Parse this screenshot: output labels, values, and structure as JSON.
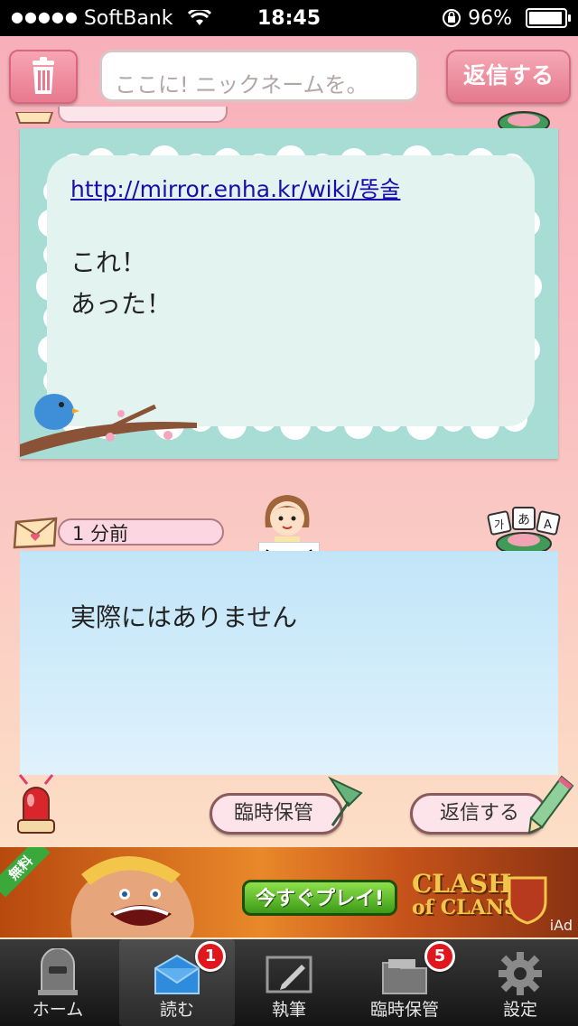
{
  "status_bar": {
    "carrier": "SoftBank",
    "time": "18:45",
    "battery": "96%"
  },
  "top_bar": {
    "nickname_placeholder": "ここに! ニックネームを。",
    "reply_label": "返信する"
  },
  "letters": [
    {
      "link": "http://mirror.enha.kr/wiki/똥술",
      "message_lines": "これ！\nあった！"
    },
    {
      "time_ago": "1 分前",
      "country_flag": "south-korea-flag-icon",
      "message": "実際にはありません"
    }
  ],
  "actions": {
    "temp_save_label": "臨時保管",
    "reply_label": "返信する"
  },
  "ad": {
    "free_label": "無料",
    "cta_label": "今すぐプレイ!",
    "brand_line1": "CLASH",
    "brand_line2": "of CLANS",
    "iad": "iAd"
  },
  "tabs": [
    {
      "label": "ホーム",
      "icon": "mailbox-icon"
    },
    {
      "label": "読む",
      "icon": "open-envelope-icon",
      "badge": "1",
      "active": true
    },
    {
      "label": "執筆",
      "icon": "pen-icon"
    },
    {
      "label": "臨時保管",
      "icon": "folder-icon",
      "badge": "5"
    },
    {
      "label": "設定",
      "icon": "gear-icon"
    }
  ],
  "colors": {
    "accent_pink": "#e8798e",
    "badge_red": "#e0181d",
    "card1_bg": "#a8ddd5",
    "card2_bg": "#c1e5f8"
  }
}
